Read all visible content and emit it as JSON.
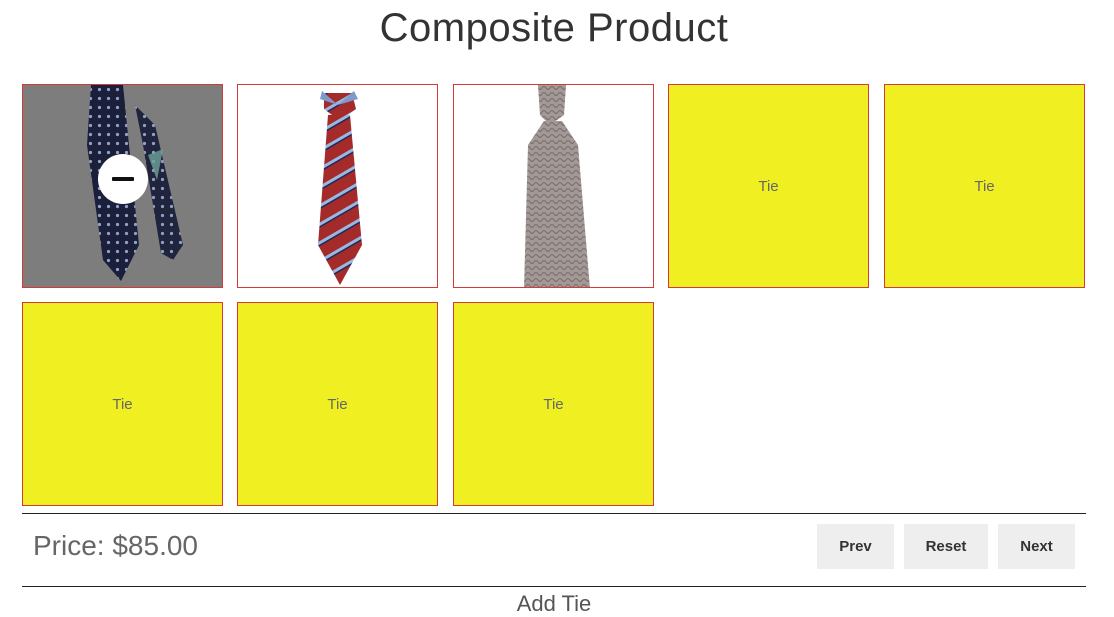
{
  "page": {
    "title": "Composite Product"
  },
  "slots": [
    {
      "state": "selected",
      "image": "navy-dotted-tie",
      "action_icon": "minus-icon"
    },
    {
      "state": "filled",
      "image": "red-striped-tie"
    },
    {
      "state": "filled",
      "image": "grey-knit-tie"
    },
    {
      "state": "empty",
      "label": "Tie"
    },
    {
      "state": "empty",
      "label": "Tie"
    },
    {
      "state": "empty",
      "label": "Tie"
    },
    {
      "state": "empty",
      "label": "Tie"
    },
    {
      "state": "empty",
      "label": "Tie"
    }
  ],
  "footer": {
    "price_label": "Price:",
    "price_value": "$85.00",
    "prev_label": "Prev",
    "reset_label": "Reset",
    "next_label": "Next",
    "add_label": "Add Tie"
  },
  "colors": {
    "placeholder": "#f0ef22",
    "tile_border": "#d43a3a",
    "selected_overlay": "#7d7d7d",
    "button_bg": "#eeeeee"
  }
}
